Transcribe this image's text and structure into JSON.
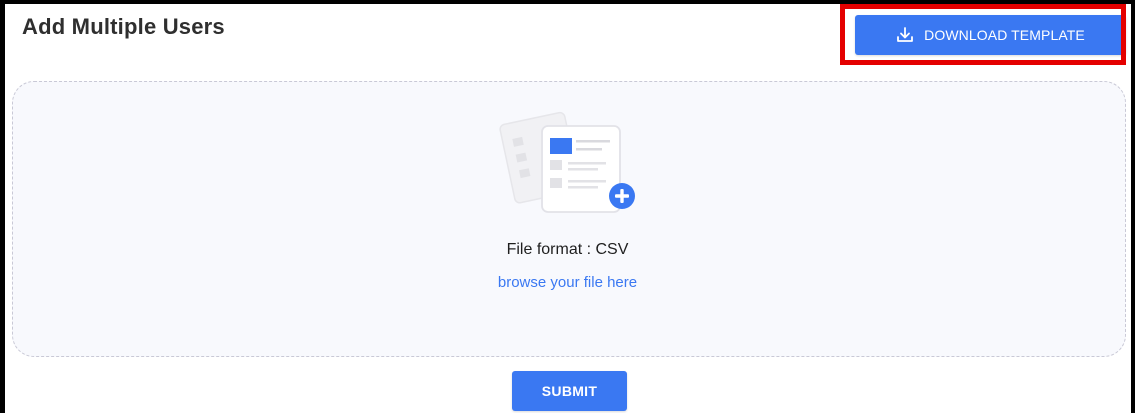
{
  "header": {
    "title": "Add Multiple Users"
  },
  "toolbar": {
    "download_template_label": "DOWNLOAD TEMPLATE",
    "download_icon": "download-icon",
    "highlight_color": "#e40000"
  },
  "upload": {
    "illustration_icon": "file-add-icon",
    "file_format_text": "File format : CSV",
    "browse_link_text": "browse your file here"
  },
  "actions": {
    "submit_label": "SUBMIT"
  },
  "colors": {
    "accent": "#3a78f2",
    "dropzone_bg": "#f8f9fd",
    "title_text": "#2f2f2f"
  }
}
